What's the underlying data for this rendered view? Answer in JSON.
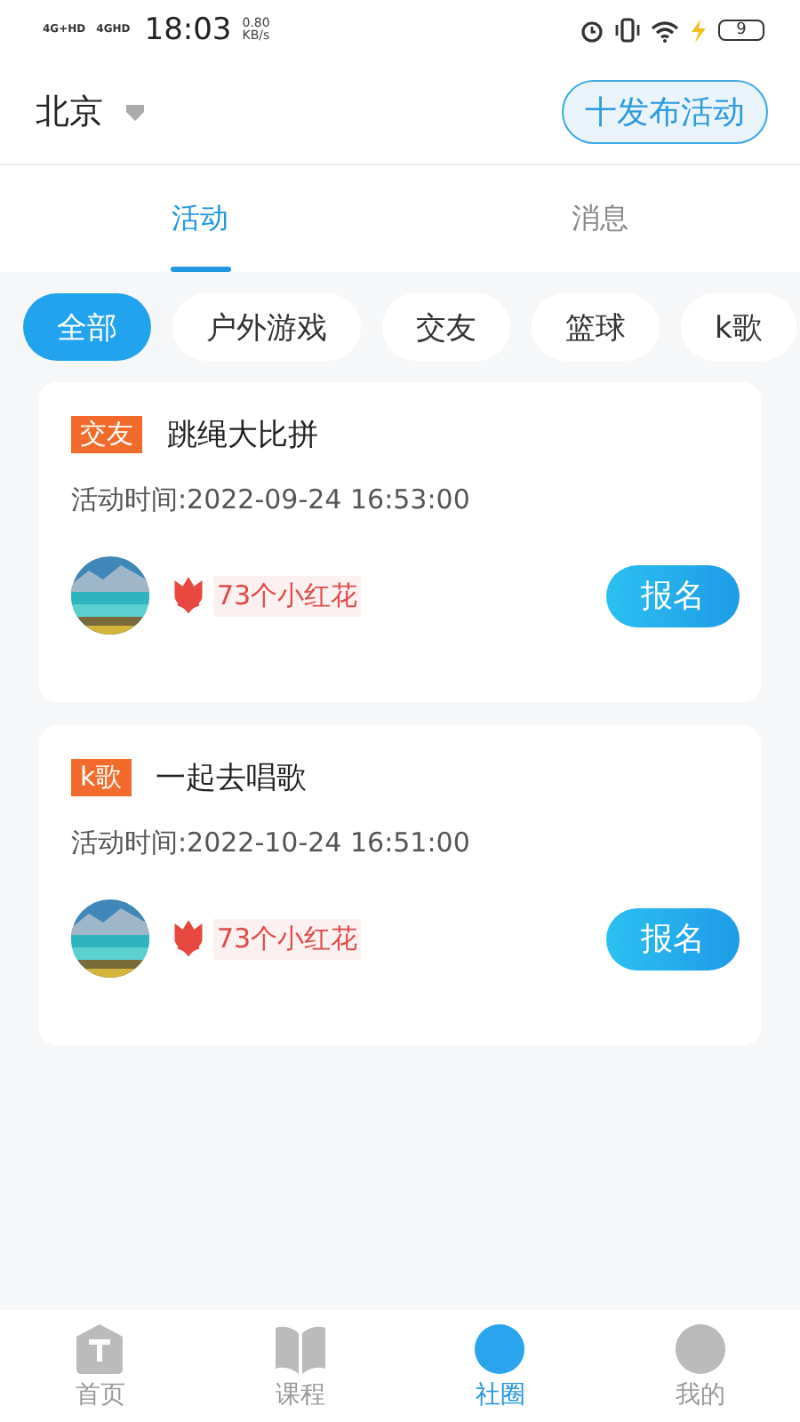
{
  "status_bar": {
    "network_1": "4G+HD",
    "network_2": "4GHD",
    "time": "18:03",
    "speed_value": "0.80",
    "speed_unit": "KB/s",
    "battery": "9"
  },
  "header": {
    "city": "北京",
    "publish_button": "十发布活动"
  },
  "tabs": [
    {
      "label": "活动",
      "selected": true
    },
    {
      "label": "消息",
      "selected": false
    }
  ],
  "filters": [
    {
      "label": "全部",
      "selected": true
    },
    {
      "label": "户外游戏",
      "selected": false
    },
    {
      "label": "交友",
      "selected": false
    },
    {
      "label": "篮球",
      "selected": false
    },
    {
      "label": "k歌",
      "selected": false
    }
  ],
  "activities": [
    {
      "tag": "交友",
      "title": "跳绳大比拼",
      "time": "活动时间:2022-09-24 16:53:00",
      "flowers": "73个小红花",
      "button": "报名"
    },
    {
      "tag": "k歌",
      "title": "一起去唱歌",
      "time": "活动时间:2022-10-24 16:51:00",
      "flowers": "73个小红花",
      "button": "报名"
    }
  ],
  "bottom_nav": [
    {
      "label": "首页",
      "selected": false,
      "kind": "home"
    },
    {
      "label": "课程",
      "selected": false,
      "kind": "book"
    },
    {
      "label": "社圈",
      "selected": true,
      "kind": "circle"
    },
    {
      "label": "我的",
      "selected": false,
      "kind": "user"
    }
  ]
}
